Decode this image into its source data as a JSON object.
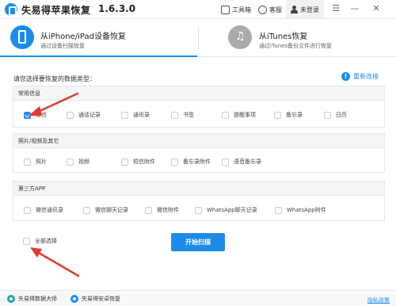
{
  "titlebar": {
    "app_name": "失易得苹果恢复",
    "version": "1.6.3.0",
    "toolbox_label": "工具箱",
    "support_label": "客服",
    "login_label": "未登录",
    "menu_icon": "menu-icon",
    "minimize_glyph": "—",
    "close_glyph": "✕"
  },
  "modes": [
    {
      "title": "从iPhone/iPad设备恢复",
      "subtitle": "通过设备扫描恢复",
      "icon": "phone-icon",
      "active": true
    },
    {
      "title": "从iTunes恢复",
      "subtitle": "通过iTunes备份文件进行恢复",
      "icon": "music-note-icon",
      "active": false
    }
  ],
  "prompt": "请您选择要恢复的数据类型：",
  "reconnect_label": "重新连接",
  "sections": [
    {
      "title": "常用信息",
      "options": [
        {
          "label": "短信",
          "checked": true
        },
        {
          "label": "通话记录",
          "checked": false
        },
        {
          "label": "通讯录",
          "checked": false
        },
        {
          "label": "书签",
          "checked": false
        },
        {
          "label": "提醒事项",
          "checked": false
        },
        {
          "label": "备忘录",
          "checked": false
        },
        {
          "label": "日历",
          "checked": false
        }
      ]
    },
    {
      "title": "照片/视频及其它",
      "options": [
        {
          "label": "照片",
          "checked": false
        },
        {
          "label": "视频",
          "checked": false
        },
        {
          "label": "短信附件",
          "checked": false
        },
        {
          "label": "备忘录附件",
          "checked": false
        },
        {
          "label": "语音备忘录",
          "checked": false
        }
      ]
    },
    {
      "title": "第三方APP",
      "options": [
        {
          "label": "微信通讯录",
          "checked": false
        },
        {
          "label": "微信聊天记录",
          "checked": false
        },
        {
          "label": "微信附件",
          "checked": false
        },
        {
          "label": "WhatsApp聊天记录",
          "checked": false
        },
        {
          "label": "WhatsApp附件",
          "checked": false
        }
      ]
    }
  ],
  "select_all_label": "全部选择",
  "start_button": "开始扫描",
  "footer": {
    "link1": "失易得数据大师",
    "link2": "失易得安卓恢复",
    "privacy": "隐私政策"
  },
  "colors": {
    "accent": "#1e8be6",
    "annotation_arrow": "#e03a2f"
  }
}
